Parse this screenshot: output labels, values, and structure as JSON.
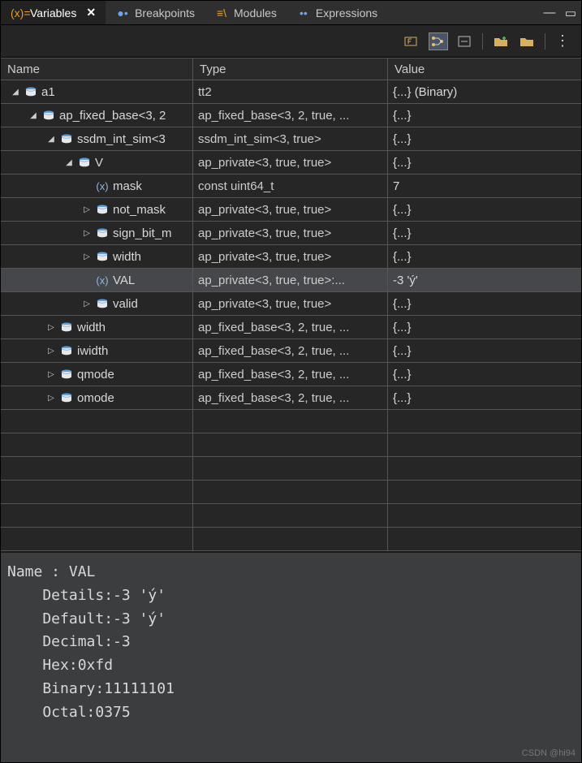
{
  "tabs": [
    {
      "label": "Variables",
      "icon": "variables",
      "active": true,
      "closable": true
    },
    {
      "label": "Breakpoints",
      "icon": "breakpoints",
      "active": false,
      "closable": false
    },
    {
      "label": "Modules",
      "icon": "modules",
      "active": false,
      "closable": false
    },
    {
      "label": "Expressions",
      "icon": "expressions",
      "active": false,
      "closable": false
    }
  ],
  "columns": {
    "name": "Name",
    "type": "Type",
    "value": "Value"
  },
  "rows": [
    {
      "indent": 0,
      "expand": "open",
      "icon": "struct",
      "name": "a1",
      "type": "tt2",
      "value": "{...} (Binary)",
      "selected": false
    },
    {
      "indent": 1,
      "expand": "open",
      "icon": "struct",
      "name": "ap_fixed_base<3, 2",
      "type": "ap_fixed_base<3, 2, true, ...",
      "value": "{...}",
      "selected": false
    },
    {
      "indent": 2,
      "expand": "open",
      "icon": "struct",
      "name": "ssdm_int_sim<3",
      "type": "ssdm_int_sim<3, true>",
      "value": "{...}",
      "selected": false
    },
    {
      "indent": 3,
      "expand": "open",
      "icon": "struct",
      "name": "V",
      "type": "ap_private<3, true, true>",
      "value": "{...}",
      "selected": false
    },
    {
      "indent": 4,
      "expand": "none",
      "icon": "field",
      "name": "mask",
      "type": "const uint64_t",
      "value": "7",
      "selected": false
    },
    {
      "indent": 4,
      "expand": "closed",
      "icon": "struct",
      "name": "not_mask",
      "type": "ap_private<3, true, true>",
      "value": "{...}",
      "selected": false
    },
    {
      "indent": 4,
      "expand": "closed",
      "icon": "struct",
      "name": "sign_bit_m",
      "type": "ap_private<3, true, true>",
      "value": "{...}",
      "selected": false
    },
    {
      "indent": 4,
      "expand": "closed",
      "icon": "struct",
      "name": "width",
      "type": "ap_private<3, true, true>",
      "value": "{...}",
      "selected": false
    },
    {
      "indent": 4,
      "expand": "none",
      "icon": "field",
      "name": "VAL",
      "type": "ap_private<3, true, true>:...",
      "value": "-3 'ý'",
      "selected": true
    },
    {
      "indent": 4,
      "expand": "closed",
      "icon": "struct",
      "name": "valid",
      "type": "ap_private<3, true, true>",
      "value": "{...}",
      "selected": false
    },
    {
      "indent": 2,
      "expand": "closed",
      "icon": "struct",
      "name": "width",
      "type": "ap_fixed_base<3, 2, true, ...",
      "value": "{...}",
      "selected": false
    },
    {
      "indent": 2,
      "expand": "closed",
      "icon": "struct",
      "name": "iwidth",
      "type": "ap_fixed_base<3, 2, true, ...",
      "value": "{...}",
      "selected": false
    },
    {
      "indent": 2,
      "expand": "closed",
      "icon": "struct",
      "name": "qmode",
      "type": "ap_fixed_base<3, 2, true, ...",
      "value": "{...}",
      "selected": false
    },
    {
      "indent": 2,
      "expand": "closed",
      "icon": "struct",
      "name": "omode",
      "type": "ap_fixed_base<3, 2, true, ...",
      "value": "{...}",
      "selected": false
    }
  ],
  "blank_row_count": 6,
  "details": {
    "name_label": "Name : ",
    "name_value": "VAL",
    "lines": [
      "    Details:-3 'ý'",
      "    Default:-3 'ý'",
      "    Decimal:-3",
      "    Hex:0xfd",
      "    Binary:11111101",
      "    Octal:0375"
    ]
  },
  "watermark": "CSDN @hi94"
}
